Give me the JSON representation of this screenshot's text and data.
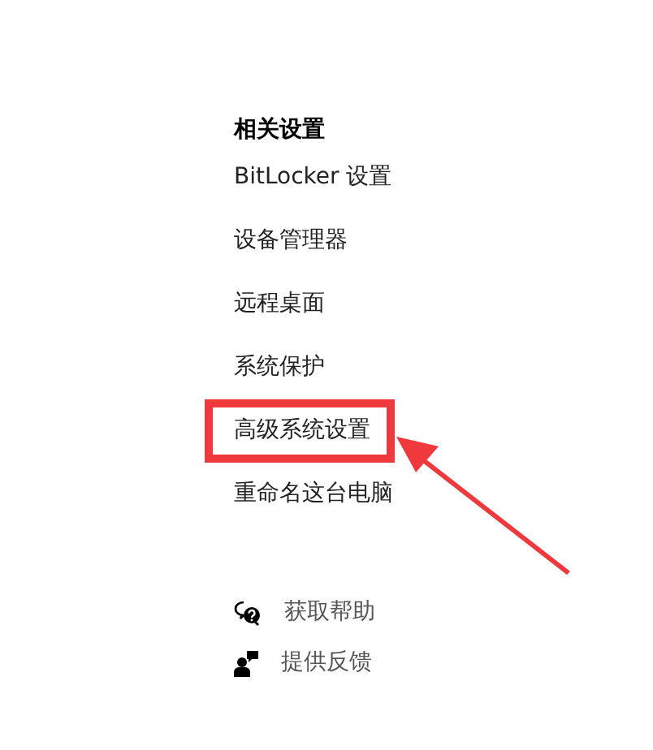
{
  "related_settings": {
    "heading": "相关设置",
    "links": [
      {
        "label": "BitLocker 设置",
        "highlighted": false
      },
      {
        "label": "设备管理器",
        "highlighted": false
      },
      {
        "label": "远程桌面",
        "highlighted": false
      },
      {
        "label": "系统保护",
        "highlighted": false
      },
      {
        "label": "高级系统设置",
        "highlighted": true
      },
      {
        "label": "重命名这台电脑",
        "highlighted": false
      }
    ]
  },
  "support_links": [
    {
      "kind": "help",
      "label": "获取帮助"
    },
    {
      "kind": "feedback",
      "label": "提供反馈"
    }
  ]
}
